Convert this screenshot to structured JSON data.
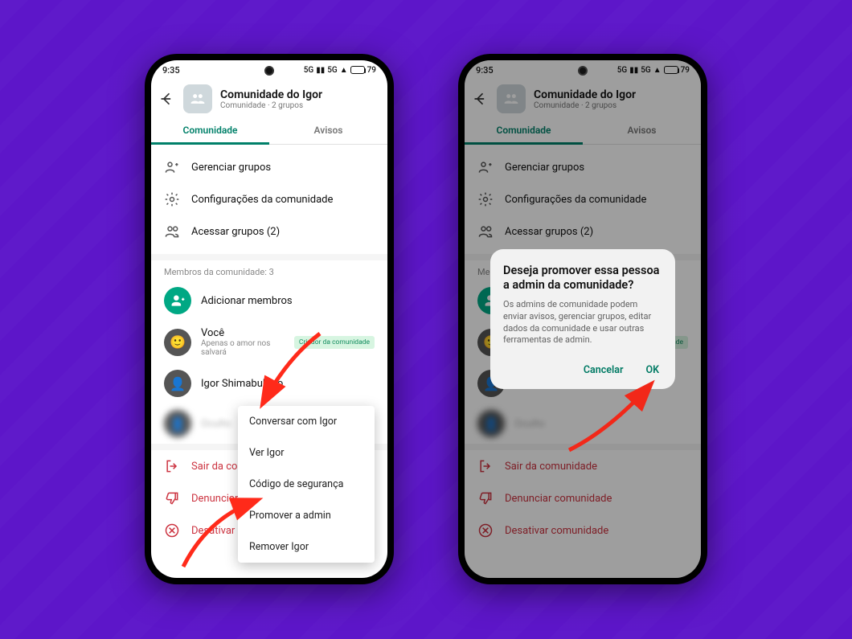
{
  "status": {
    "time": "9:35",
    "signal_label": "5G",
    "battery_pct": "79"
  },
  "header": {
    "title": "Comunidade do Igor",
    "subtitle": "Comunidade · 2 grupos"
  },
  "tabs": {
    "community": "Comunidade",
    "announcements": "Avisos"
  },
  "actions": {
    "manage_groups": "Gerenciar grupos",
    "community_settings": "Configurações da comunidade",
    "access_groups": "Acessar grupos (2)"
  },
  "members": {
    "heading": "Membros da comunidade: 3",
    "add_label": "Adicionar membros",
    "you": {
      "name": "Você",
      "status": "Apenas o amor nos salvará",
      "badge": "Criador da comunidade"
    },
    "igor": {
      "name": "Igor Shimabukuro"
    },
    "hidden": {
      "name": "Oculto"
    }
  },
  "danger": {
    "leave": "Sair da comunidade",
    "report": "Denunciar comunidade",
    "deactivate": "Desativar comunidade"
  },
  "context_menu": {
    "chat": "Conversar com Igor",
    "view": "Ver Igor",
    "security": "Código de segurança",
    "promote": "Promover a admin",
    "remove": "Remover Igor"
  },
  "dialog": {
    "title": "Deseja promover essa pessoa a admin da comunidade?",
    "body": "Os admins de comunidade podem enviar avisos, gerenciar grupos, editar dados da comunidade e usar outras ferramentas de admin.",
    "cancel": "Cancelar",
    "ok": "OK"
  }
}
